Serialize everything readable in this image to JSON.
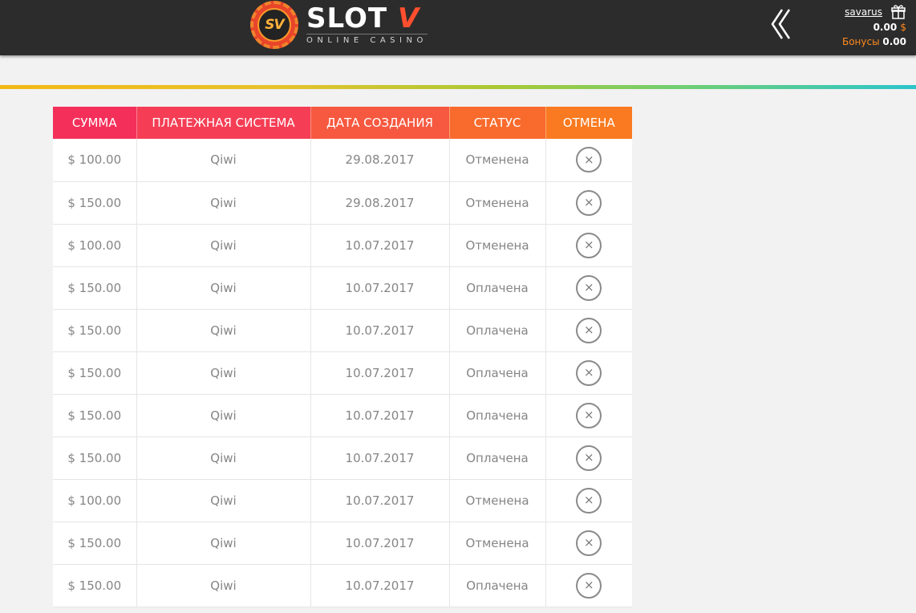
{
  "header": {
    "logo_badge": "SV",
    "logo_title_main": "SLOT",
    "logo_title_accent": "V",
    "logo_subtitle": "ONLINE CASINO",
    "back_icon": "double-chevron-left-icon",
    "username": "savarus",
    "gift_icon": "gift-icon",
    "balance_value": "0.00",
    "balance_currency": "$",
    "bonus_label": "Бонусы",
    "bonus_value": "0.00"
  },
  "colors": {
    "topbar": "#2c2c2c",
    "accent_orange": "#ff8a1f",
    "header_pink": "#f4305a",
    "header_orange": "#f97a20"
  },
  "table": {
    "columns": [
      "СУММА",
      "ПЛАТЕЖНАЯ СИСТЕМА",
      "ДАТА СОЗДАНИЯ",
      "СТАТУС",
      "ОТМЕНА"
    ],
    "cancel_icon": "close-circle-icon",
    "cancel_glyph": "×",
    "rows": [
      {
        "amount": "$ 100.00",
        "system": "Qiwi",
        "date": "29.08.2017",
        "status": "Отменена"
      },
      {
        "amount": "$ 150.00",
        "system": "Qiwi",
        "date": "29.08.2017",
        "status": "Отменена"
      },
      {
        "amount": "$ 100.00",
        "system": "Qiwi",
        "date": "10.07.2017",
        "status": "Отменена"
      },
      {
        "amount": "$ 150.00",
        "system": "Qiwi",
        "date": "10.07.2017",
        "status": "Оплачена"
      },
      {
        "amount": "$ 150.00",
        "system": "Qiwi",
        "date": "10.07.2017",
        "status": "Оплачена"
      },
      {
        "amount": "$ 150.00",
        "system": "Qiwi",
        "date": "10.07.2017",
        "status": "Оплачена"
      },
      {
        "amount": "$ 150.00",
        "system": "Qiwi",
        "date": "10.07.2017",
        "status": "Оплачена"
      },
      {
        "amount": "$ 150.00",
        "system": "Qiwi",
        "date": "10.07.2017",
        "status": "Оплачена"
      },
      {
        "amount": "$ 100.00",
        "system": "Qiwi",
        "date": "10.07.2017",
        "status": "Отменена"
      },
      {
        "amount": "$ 150.00",
        "system": "Qiwi",
        "date": "10.07.2017",
        "status": "Отменена"
      },
      {
        "amount": "$ 150.00",
        "system": "Qiwi",
        "date": "10.07.2017",
        "status": "Оплачена"
      }
    ]
  }
}
